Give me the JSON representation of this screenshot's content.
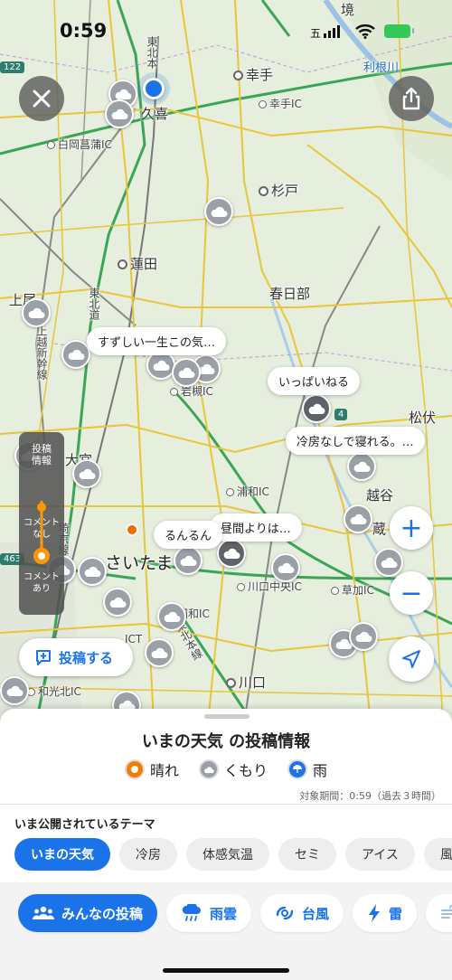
{
  "status": {
    "time": "0:59",
    "carrier": "五"
  },
  "map": {
    "places": [
      {
        "name": "幸手"
      },
      {
        "name": "幸手IC"
      },
      {
        "name": "久喜"
      },
      {
        "name": "白岡菖蒲IC"
      },
      {
        "name": "杉戸"
      },
      {
        "name": "蓮田"
      },
      {
        "name": "上尾"
      },
      {
        "name": "春日部"
      },
      {
        "name": "岩槻IC"
      },
      {
        "name": "松伏"
      },
      {
        "name": "大宮"
      },
      {
        "name": "越谷"
      },
      {
        "name": "浦和IC"
      },
      {
        "name": "さいたま"
      },
      {
        "name": "川口中央IC"
      },
      {
        "name": "草加IC"
      },
      {
        "name": "浦和IC"
      },
      {
        "name": "川口"
      },
      {
        "name": "和光北IC"
      },
      {
        "name": "利根川"
      },
      {
        "name": "東北本"
      },
      {
        "name": "東北道"
      },
      {
        "name": "上越新幹線"
      },
      {
        "name": "埼京線"
      },
      {
        "name": "JCT"
      },
      {
        "name": "東北本線"
      },
      {
        "name": "境"
      },
      {
        "name": "蔵"
      }
    ],
    "shields": [
      "122",
      "4",
      "463"
    ],
    "bubbles": [
      {
        "text": "すずしい一生この気…"
      },
      {
        "text": "いっぱいねる"
      },
      {
        "text": "冷房なしで寝れる。…"
      },
      {
        "text": "るんるん"
      },
      {
        "text": "昼間よりは…"
      }
    ]
  },
  "controls": {
    "close_icon": "close-icon",
    "share_icon": "share-icon",
    "zoom_in": "+",
    "zoom_out": "−",
    "post_button": "投稿する",
    "filter": {
      "title": "投稿\n情報",
      "no_comment": "コメント\nなし",
      "with_comment": "コメント\nあり"
    }
  },
  "sheet": {
    "title": "いまの天気 の投稿情報",
    "legend": [
      {
        "label": "晴れ",
        "color": "#f57c00"
      },
      {
        "label": "くもり",
        "color": "#9aa0a6"
      },
      {
        "label": "雨",
        "color": "#1a73e8"
      }
    ],
    "period": "対象期間：0:59（過去３時間）",
    "themes_heading": "いま公開されているテーマ",
    "themes": [
      "いまの天気",
      "冷房",
      "体感気温",
      "セミ",
      "アイス",
      "風"
    ],
    "layers": [
      "みんなの投稿",
      "雨雲",
      "台風",
      "雷"
    ]
  },
  "colors": {
    "accent": "#1a73e8",
    "sunny": "#f57c00",
    "cloudy": "#9aa0a6"
  }
}
